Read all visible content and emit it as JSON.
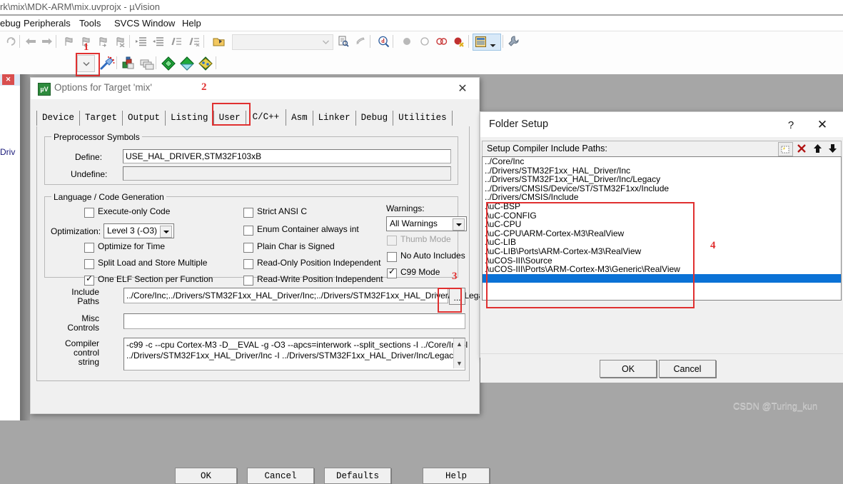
{
  "ide": {
    "title": "rk\\mix\\MDK-ARM\\mix.uvprojx - µVision",
    "menu": [
      "ebug",
      "Peripherals",
      "Tools",
      "SVCS",
      "Window",
      "Help"
    ],
    "project_pane": {
      "close_label": "✕",
      "text": "Driv"
    },
    "toolbar1_icons": [
      "redo-icon",
      "back-icon",
      "forward-icon",
      "bookmark-toggle-icon",
      "bookmark-prev-icon",
      "bookmark-next-icon",
      "bookmark-clear-icon",
      "indent-icon",
      "outdent-icon",
      "comment-icon",
      "uncomment-icon",
      "open-folder-icon"
    ],
    "toolbar1_right_icons": [
      "combo-dropdown-icon",
      "find-in-files-icon",
      "insert-icon",
      "debug-find-icon",
      "breakpoint-filled-icon",
      "breakpoint-empty-icon",
      "disable-breakpoints-icon",
      "kill-breakpoints-icon",
      "window-manager-icon",
      "window-manager-arrow-icon",
      "configure-icon"
    ],
    "toolbar2_icons": [
      "dropdown-arrow-icon",
      "target-options-icon",
      "manage-project-items-icon",
      "batch-build-icon",
      "run-to-main-icon",
      "download-icon",
      "flash-icon"
    ],
    "annotation_1": "1"
  },
  "options_dialog": {
    "title": "Options for Target 'mix'",
    "app_icon": "uvision-icon",
    "close_label": "✕",
    "annotation_2": "2",
    "annotation_3": "3",
    "tabs": [
      {
        "label": "Device",
        "active": false
      },
      {
        "label": "Target",
        "active": false
      },
      {
        "label": "Output",
        "active": false
      },
      {
        "label": "Listing",
        "active": false
      },
      {
        "label": "User",
        "active": false
      },
      {
        "label": "C/C++",
        "active": true
      },
      {
        "label": "Asm",
        "active": false
      },
      {
        "label": "Linker",
        "active": false
      },
      {
        "label": "Debug",
        "active": false
      },
      {
        "label": "Utilities",
        "active": false
      }
    ],
    "preprocessor": {
      "group_title": "Preprocessor Symbols",
      "define_label": "Define:",
      "define_value": "USE_HAL_DRIVER,STM32F103xB",
      "undefine_label": "Undefine:",
      "undefine_value": ""
    },
    "language": {
      "group_title": "Language / Code Generation",
      "left_checkboxes": [
        {
          "label": "Execute-only Code",
          "checked": false,
          "disabled": false
        },
        {
          "label": "Optimize for Time",
          "checked": false,
          "disabled": false
        },
        {
          "label": "Split Load and Store Multiple",
          "checked": false,
          "disabled": false
        },
        {
          "label": "One ELF Section per Function",
          "checked": true,
          "disabled": false
        }
      ],
      "optimization_label": "Optimization:",
      "optimization_value": "Level 3 (-O3)",
      "middle_checkboxes": [
        {
          "label": "Strict ANSI C",
          "checked": false,
          "disabled": false
        },
        {
          "label": "Enum Container always int",
          "checked": false,
          "disabled": false
        },
        {
          "label": "Plain Char is Signed",
          "checked": false,
          "disabled": false
        },
        {
          "label": "Read-Only Position Independent",
          "checked": false,
          "disabled": false
        },
        {
          "label": "Read-Write Position Independent",
          "checked": false,
          "disabled": false
        }
      ],
      "warnings_label": "Warnings:",
      "warnings_value": "All Warnings",
      "right_checkboxes": [
        {
          "label": "Thumb Mode",
          "checked": false,
          "disabled": true
        },
        {
          "label": "No Auto Includes",
          "checked": false,
          "disabled": false
        },
        {
          "label": "C99 Mode",
          "checked": true,
          "disabled": false
        }
      ]
    },
    "include_paths_label_l1": "Include",
    "include_paths_label_l2": "Paths",
    "include_paths_value": "../Core/Inc;../Drivers/STM32F1xx_HAL_Driver/Inc;../Drivers/STM32F1xx_HAL_Driver/Inc/Legacy;",
    "browse_button_label": "...",
    "misc_label_l1": "Misc",
    "misc_label_l2": "Controls",
    "misc_value": "",
    "compiler_label_l1": "Compiler",
    "compiler_label_l2": "control",
    "compiler_label_l3": "string",
    "compiler_value_line1": "-c99 -c --cpu Cortex-M3 -D__EVAL -g -O3 --apcs=interwork --split_sections -I ../Core/Inc -I",
    "compiler_value_line2": "../Drivers/STM32F1xx_HAL_Driver/Inc -I ../Drivers/STM32F1xx_HAL_Driver/Inc/Legacy -I",
    "buttons": [
      "OK",
      "Cancel",
      "Defaults",
      "Help"
    ]
  },
  "folder_setup": {
    "title": "Folder Setup",
    "help_label": "?",
    "close_label": "✕",
    "annotation_4": "4",
    "toolbar_label": "Setup Compiler Include Paths:",
    "tool_buttons": [
      "new-path-icon",
      "delete-path-icon",
      "move-up-icon",
      "move-down-icon"
    ],
    "paths": [
      {
        "text": "../Core/Inc",
        "selected": false
      },
      {
        "text": "../Drivers/STM32F1xx_HAL_Driver/Inc",
        "selected": false
      },
      {
        "text": "../Drivers/STM32F1xx_HAL_Driver/Inc/Legacy",
        "selected": false
      },
      {
        "text": "../Drivers/CMSIS/Device/ST/STM32F1xx/Include",
        "selected": false
      },
      {
        "text": "../Drivers/CMSIS/Include",
        "selected": false
      },
      {
        "text": ".\\uC-BSP",
        "selected": false
      },
      {
        "text": ".\\uC-CONFIG",
        "selected": false
      },
      {
        "text": ".\\uC-CPU",
        "selected": false
      },
      {
        "text": ".\\uC-CPU\\ARM-Cortex-M3\\RealView",
        "selected": false
      },
      {
        "text": ".\\uC-LIB",
        "selected": false
      },
      {
        "text": ".\\uC-LIB\\Ports\\ARM-Cortex-M3\\RealView",
        "selected": false
      },
      {
        "text": ".\\uCOS-III\\Source",
        "selected": false
      },
      {
        "text": ".\\uCOS-III\\Ports\\ARM-Cortex-M3\\Generic\\RealView",
        "selected": false
      },
      {
        "text": "",
        "selected": true
      }
    ],
    "ok_label": "OK",
    "cancel_label": "Cancel"
  },
  "watermark": "CSDN @Turing_kun",
  "colors": {
    "annotation_red": "#e03030",
    "selection_blue": "#0b72d6",
    "dialog_face": "#f0f0f0"
  }
}
